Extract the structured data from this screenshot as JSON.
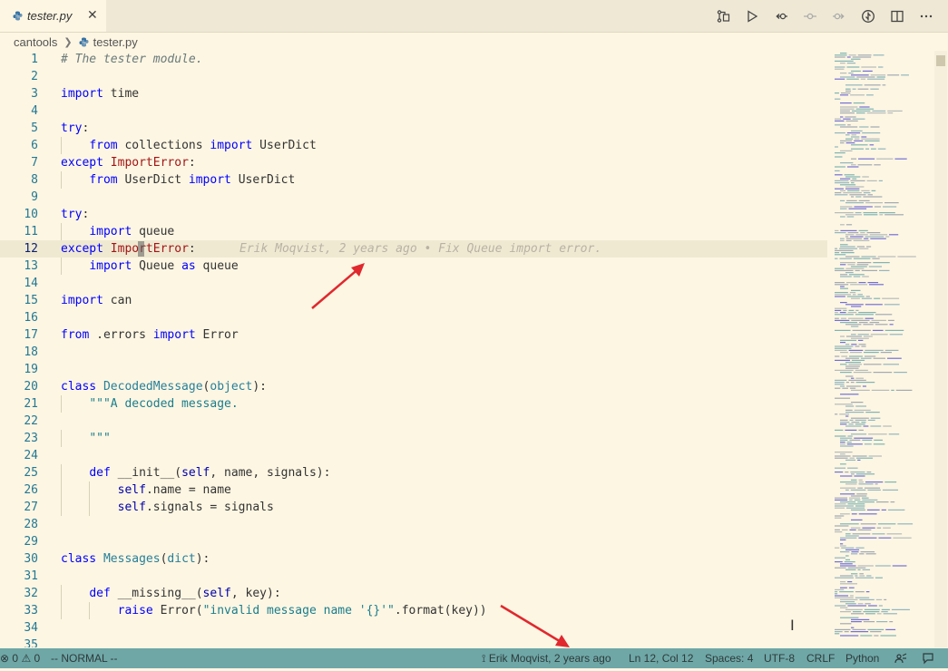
{
  "tab": {
    "label": "tester.py",
    "close": "✕",
    "icon": "python-file-icon"
  },
  "editor_actions": [
    "open-changes-icon",
    "run-icon",
    "previous-change-icon",
    "blame-icon",
    "next-change-icon",
    "toggle-blame-icon",
    "split-editor-icon",
    "more-actions-icon"
  ],
  "breadcrumb": {
    "folder": "cantools",
    "file": "tester.py"
  },
  "lines": [
    {
      "n": "1",
      "t": "# The tester module."
    },
    {
      "n": "2",
      "t": ""
    },
    {
      "n": "3",
      "t": "import time"
    },
    {
      "n": "4",
      "t": ""
    },
    {
      "n": "5",
      "t": "try:"
    },
    {
      "n": "6",
      "t": "    from collections import UserDict"
    },
    {
      "n": "7",
      "t": "except ImportError:"
    },
    {
      "n": "8",
      "t": "    from UserDict import UserDict"
    },
    {
      "n": "9",
      "t": ""
    },
    {
      "n": "10",
      "t": "try:"
    },
    {
      "n": "11",
      "t": "    import queue"
    },
    {
      "n": "12",
      "t": "except ImportError:"
    },
    {
      "n": "13",
      "t": "    import Queue as queue"
    },
    {
      "n": "14",
      "t": ""
    },
    {
      "n": "15",
      "t": "import can"
    },
    {
      "n": "16",
      "t": ""
    },
    {
      "n": "17",
      "t": "from .errors import Error"
    },
    {
      "n": "18",
      "t": ""
    },
    {
      "n": "19",
      "t": ""
    },
    {
      "n": "20",
      "t": "class DecodedMessage(object):"
    },
    {
      "n": "21",
      "t": "    \"\"\"A decoded message."
    },
    {
      "n": "22",
      "t": ""
    },
    {
      "n": "23",
      "t": "    \"\"\""
    },
    {
      "n": "24",
      "t": ""
    },
    {
      "n": "25",
      "t": "    def __init__(self, name, signals):"
    },
    {
      "n": "26",
      "t": "        self.name = name"
    },
    {
      "n": "27",
      "t": "        self.signals = signals"
    },
    {
      "n": "28",
      "t": ""
    },
    {
      "n": "29",
      "t": ""
    },
    {
      "n": "30",
      "t": "class Messages(dict):"
    },
    {
      "n": "31",
      "t": ""
    },
    {
      "n": "32",
      "t": "    def __missing__(self, key):"
    },
    {
      "n": "33",
      "t": "        raise Error(\"invalid message name '{}'\".format(key))"
    },
    {
      "n": "34",
      "t": ""
    },
    {
      "n": "35",
      "t": ""
    }
  ],
  "blame_inline": "Erik Moqvist, 2 years ago • Fix Queue import error.",
  "status": {
    "problems_errors": "0",
    "problems_warnings": "0",
    "mode": "-- NORMAL --",
    "blame": "Erik Moqvist, 2 years ago",
    "position": "Ln 12, Col 12",
    "spaces": "Spaces: 4",
    "encoding": "UTF-8",
    "eol": "CRLF",
    "language": "Python"
  },
  "colors": {
    "background": "#fdf6e3",
    "statusbar": "#6fa7a7",
    "keyword": "#0000ff",
    "annotation_arrow": "#e0282e"
  }
}
